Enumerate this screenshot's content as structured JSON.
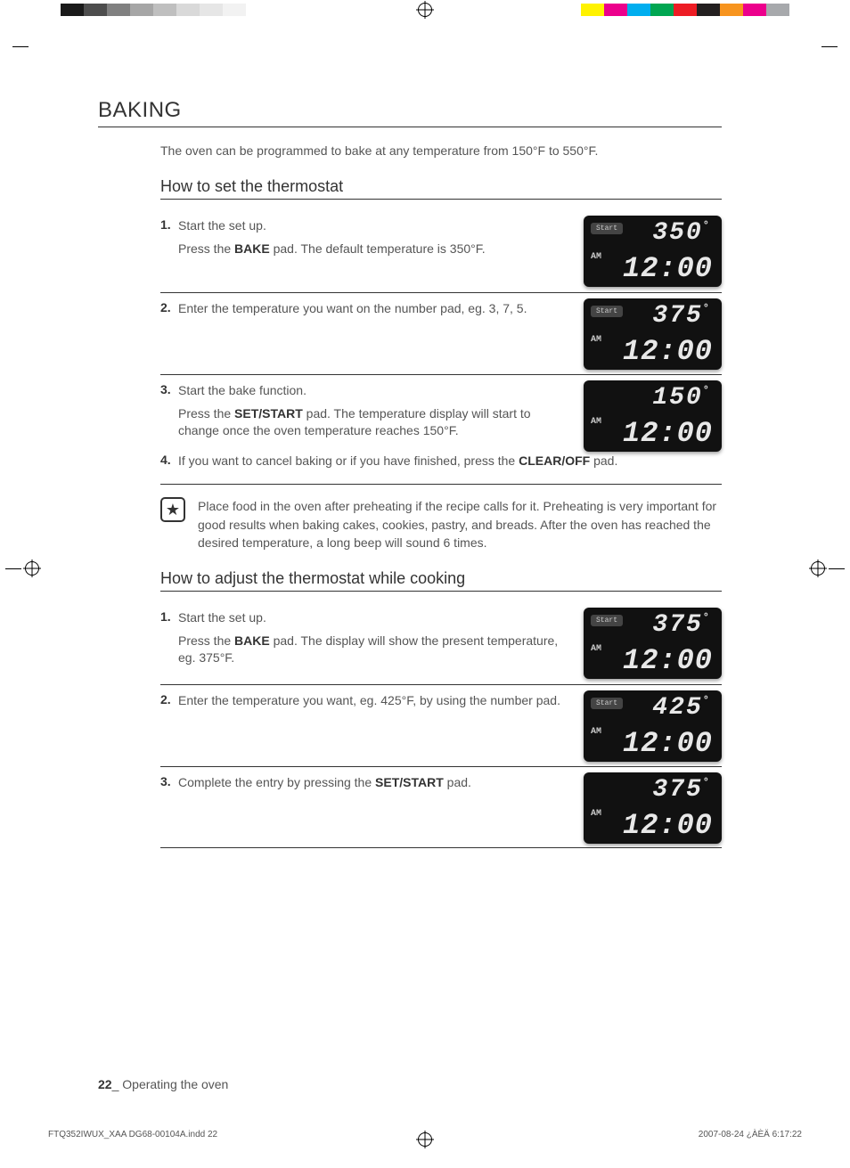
{
  "top_strip_left": [
    "#1a1a1a",
    "#4d4d4d",
    "#808080",
    "#a6a6a6",
    "#bfbfbf",
    "#d9d9d9",
    "#e6e6e6",
    "#f2f2f2",
    "#ffffff"
  ],
  "top_strip_right": [
    "#fff200",
    "#ec008c",
    "#00aeef",
    "#00a651",
    "#ed1c24",
    "#231f20",
    "#f7941e",
    "#ec008c",
    "#a7a9ac"
  ],
  "heading": "BAKING",
  "intro": "The oven can be programmed to bake at any temperature from 150°F to 550°F.",
  "sec1_title": "How to set the thermostat",
  "s1": {
    "n": "1",
    "l1": "Start the set up.",
    "l2a": "Press the ",
    "l2b": "BAKE",
    "l2c": " pad. The default temperature is 350°F.",
    "disp": {
      "start": "Start",
      "am": "AM",
      "temp": "350",
      "time": "12:00"
    }
  },
  "s2": {
    "n": "2",
    "l1": "Enter the temperature you want on the number pad, eg. 3, 7, 5.",
    "disp": {
      "start": "Start",
      "am": "AM",
      "temp": "375",
      "time": "12:00"
    }
  },
  "s3": {
    "n": "3",
    "l1": "Start the bake function.",
    "l2a": "Press the ",
    "l2b": "SET/START",
    "l2c": " pad. The temperature display will start to change once the oven temperature reaches 150°F.",
    "disp": {
      "am": "AM",
      "temp": "150",
      "time": "12:00"
    }
  },
  "s4": {
    "n": "4",
    "l1a": "If you want to cancel baking or if you have finished, press the ",
    "l1b": "CLEAR/OFF",
    "l1c": " pad."
  },
  "note": "Place food in the oven after preheating if the recipe calls for it. Preheating is very important for good results when baking cakes, cookies, pastry, and breads. After the oven has reached the desired temperature, a long beep will sound 6 times.",
  "sec2_title": "How to adjust the thermostat while cooking",
  "a1": {
    "n": "1",
    "l1": "Start the set up.",
    "l2a": "Press the ",
    "l2b": "BAKE",
    "l2c": " pad. The display will show the present temperature, eg. 375°F.",
    "disp": {
      "start": "Start",
      "am": "AM",
      "temp": "375",
      "time": "12:00"
    }
  },
  "a2": {
    "n": "2",
    "l1": "Enter the temperature you want, eg. 425°F, by using the number pad.",
    "disp": {
      "start": "Start",
      "am": "AM",
      "temp": "425",
      "time": "12:00"
    }
  },
  "a3": {
    "n": "3",
    "l1a": "Complete the entry by pressing the ",
    "l1b": "SET/START",
    "l1c": " pad.",
    "disp": {
      "am": "AM",
      "temp": "375",
      "time": "12:00"
    }
  },
  "footer_page": "22",
  "footer_sep": "_",
  "footer_text": " Operating the oven",
  "meta_left": "FTQ352IWUX_XAA DG68-00104A.indd   22",
  "meta_right": "2007-08-24   ¿ÀÈÄ 6:17:22"
}
